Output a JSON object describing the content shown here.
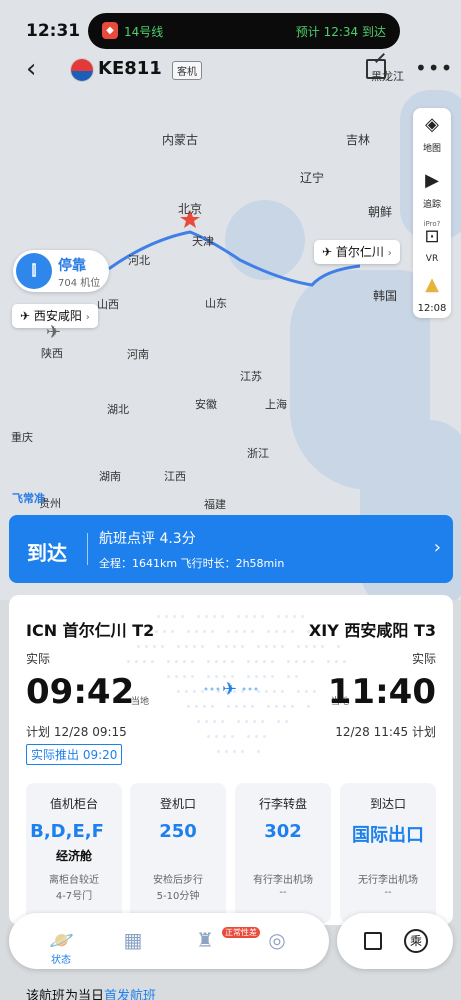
{
  "status_bar": {
    "time": "12:31",
    "island_line": "14号线",
    "island_eta": "预计 12:34 到达"
  },
  "nav": {
    "flight_number": "KE811",
    "aircraft_type": "客机"
  },
  "map": {
    "labels": {
      "inner_mongolia": "内蒙古",
      "jilin": "吉林",
      "liaoning": "辽宁",
      "heilongjiang": "黑龙江",
      "beijing": "北京",
      "tianjin": "天津",
      "hebei": "河北",
      "shanxi": "山西",
      "shandong": "山东",
      "north_korea": "朝鲜",
      "south_korea": "韩国",
      "shaanxi": "陕西",
      "henan": "河南",
      "jiangsu": "江苏",
      "anhui": "安徽",
      "shanghai": "上海",
      "hubei": "湖北",
      "zhejiang": "浙江",
      "chongqing": "重庆",
      "hunan": "湖南",
      "jiangxi": "江西",
      "fujian": "福建",
      "guizhou": "贵州",
      "feichang": "飞常准"
    },
    "tools": {
      "layers": "地图",
      "track": "追踪",
      "vr_badge": "iPro?",
      "vr": "VR",
      "weather_time": "12:08"
    },
    "dep_tag": "首尔仁川",
    "arr_tag": "西安咸阳",
    "stand": {
      "title": "停靠",
      "subtitle": "704 机位"
    }
  },
  "banner": {
    "status": "到达",
    "rating": "航班点评 4.3分",
    "route": "全程：1641km  飞行时长：2h58min"
  },
  "flight": {
    "dep_header": "ICN 首尔仁川 T2",
    "arr_header": "XIY 西安咸阳 T3",
    "dep_actual_label": "实际",
    "arr_actual_label": "实际",
    "dep_time": "09:42",
    "arr_time": "11:40",
    "dep_local": "当地",
    "arr_local": "当地",
    "dep_sched": "计划 12/28 09:15",
    "arr_sched": "12/28 11:45 计划",
    "pushback": "实际推出 09:20"
  },
  "info_boxes": [
    {
      "title": "值机柜台",
      "value": "B,D,E,F",
      "sub": "经济舱",
      "note1": "离柜台较近",
      "note2": "4-7号门"
    },
    {
      "title": "登机口",
      "value": "250",
      "sub": "",
      "note1": "安检后步行",
      "note2": "5-10分钟"
    },
    {
      "title": "行李转盘",
      "value": "302",
      "sub": "",
      "note1": "有行李出机场",
      "note2": "--"
    },
    {
      "title": "到达口",
      "value": "国际出口",
      "sub": "",
      "note1": "无行李出机场",
      "note2": "--"
    }
  ],
  "tabs": [
    {
      "label": "状态"
    },
    {
      "label": ""
    },
    {
      "label": ""
    },
    {
      "label": ""
    }
  ],
  "tab_badge": "正常性差",
  "actions": {
    "ride_glyph": "乘"
  },
  "footer": {
    "text": "该航班为当日",
    "link": "首发航班"
  },
  "colors": {
    "accent": "#1e80ec",
    "route": "#3f7fe6"
  }
}
